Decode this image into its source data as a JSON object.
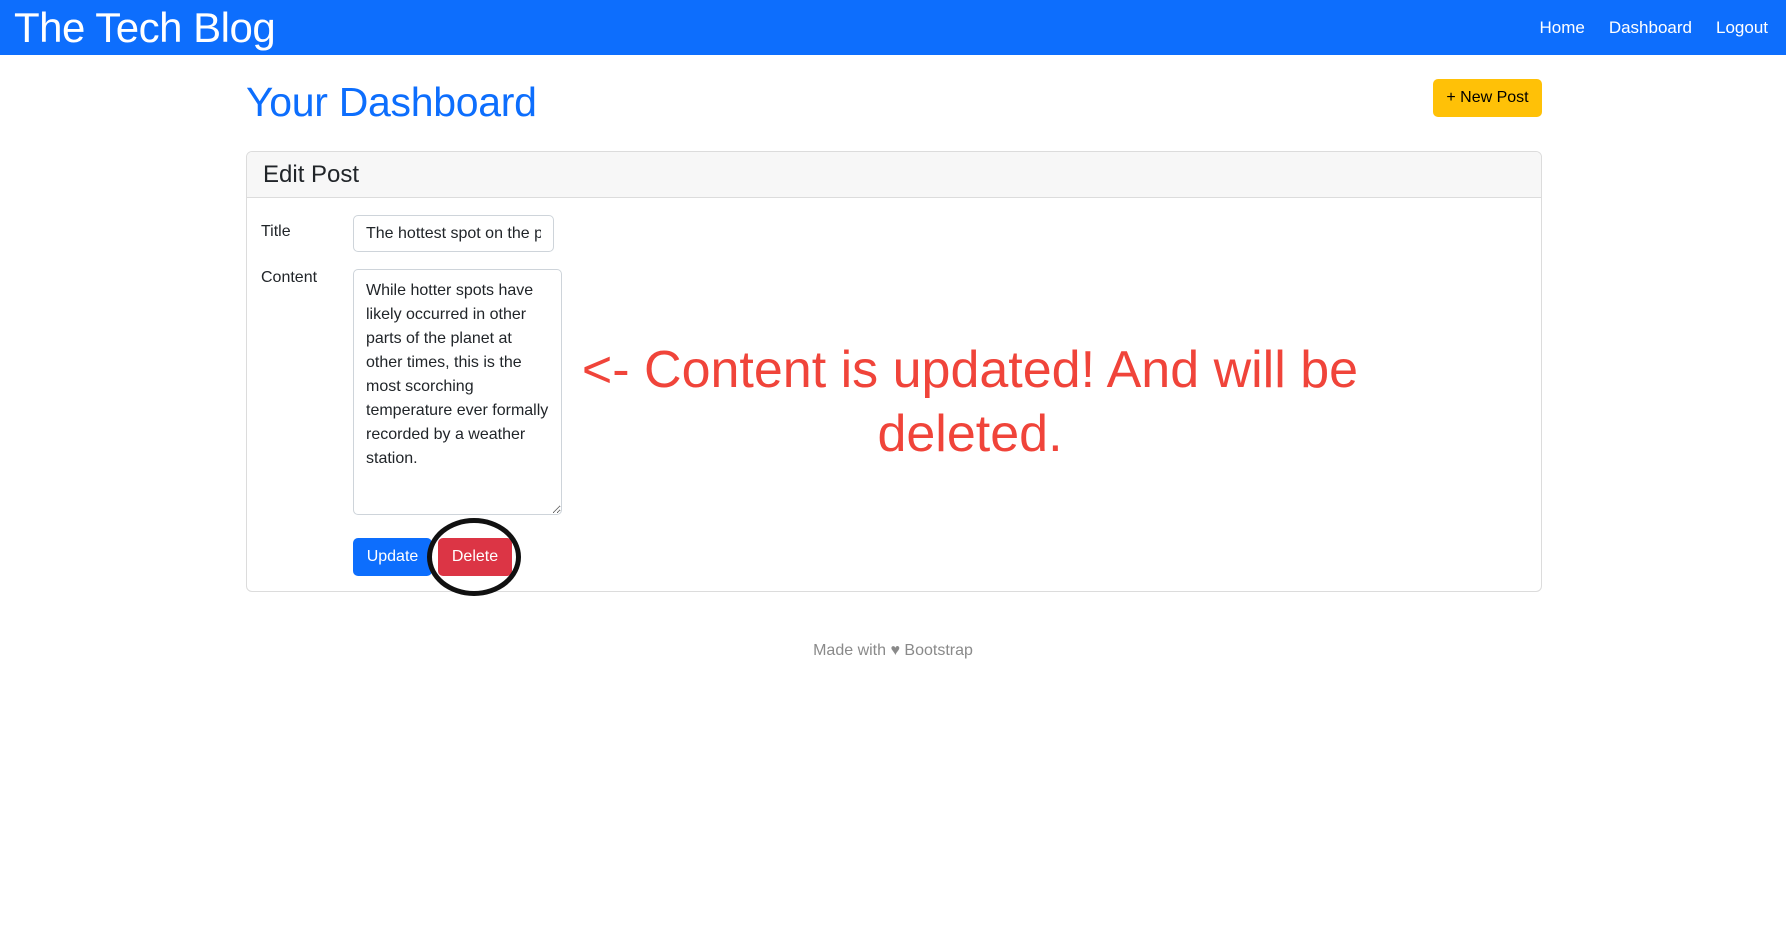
{
  "navbar": {
    "brand": "The Tech Blog",
    "links": [
      "Home",
      "Dashboard",
      "Logout"
    ]
  },
  "page": {
    "title": "Your Dashboard",
    "new_post_label": "+ New Post"
  },
  "edit_post": {
    "header": "Edit Post",
    "title_label": "Title",
    "title_value": "The hottest spot on the planet",
    "content_label": "Content",
    "content_value": "While hotter spots have likely occurred in other parts of the planet at other times, this is the most scorching temperature ever formally recorded by a weather station.",
    "update_label": "Update",
    "delete_label": "Delete"
  },
  "annotation": {
    "note": "<- Content is updated! And will be deleted.",
    "color": "#f0443a"
  },
  "footer": {
    "prefix": "Made with",
    "heart_icon": "heart-icon",
    "suffix": "Bootstrap"
  },
  "colors": {
    "primary": "#0d6efd",
    "warning": "#ffc107",
    "danger": "#dc3545"
  }
}
